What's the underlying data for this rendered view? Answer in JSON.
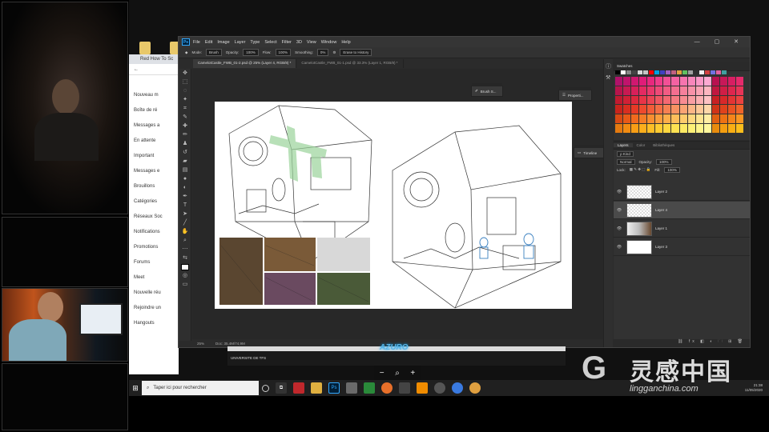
{
  "browser": {
    "tab_title": "Red How To Sc",
    "rows": [
      "Nouveau m",
      "Boîte de ré",
      "Messages a",
      "En attente",
      "Important",
      "Messages e",
      "Brouillons",
      "Catégories",
      "Réseaux Soc",
      "Notifications",
      "Promotions",
      "Forums",
      "Meet",
      "Nouvelle réu",
      "Rejoindre un",
      "Hangouts"
    ]
  },
  "photoshop": {
    "logo": "Ps",
    "menu": [
      "File",
      "Edit",
      "Image",
      "Layer",
      "Type",
      "Select",
      "Filter",
      "3D",
      "View",
      "Window",
      "Help"
    ],
    "window_controls": "— ▢ ✕",
    "options": {
      "mode_label": "Mode:",
      "mode_value": "Brush",
      "opacity_label": "Opacity:",
      "opacity_value": "100%",
      "flow_label": "Flow:",
      "flow_value": "100%",
      "smoothing_label": "Smoothing:",
      "smoothing_value": "0%",
      "erase_history": "Erase to History"
    },
    "tabs": [
      "CamelotCastle_FWB_01-2.psd @ 25% (Layer 4, RGB/8) *",
      "CamelotCastle_FWB_01-1.psd @ 33.3% (Layer 1, RGB/8) *"
    ],
    "status": {
      "zoom": "25%",
      "doc": "Doc: 35,4M/74,9M"
    },
    "float_panels": {
      "brush": "Brush S...",
      "properties": "Properti...",
      "timeline": "Timeline"
    },
    "swatches": {
      "title": "Swatches",
      "recent_colors": [
        "#000000",
        "#ffffff",
        "#888888",
        "#444444",
        "#d8d8d8",
        "#c4c4c4",
        "#ff0000",
        "#00a0e0",
        "#4040c0",
        "#a060c0",
        "#c06080",
        "#e0a040",
        "#60c060",
        "#a0a0a0",
        "#303030",
        "#f0f0f0",
        "#d04040",
        "#7070e0",
        "#e060a0",
        "#40a0a0"
      ],
      "palette": [
        "#b0126a",
        "#c0146c",
        "#d01870",
        "#e01c78",
        "#e8287e",
        "#ee3c8a",
        "#f25096",
        "#f462a2",
        "#f674ae",
        "#f886ba",
        "#fa98c6",
        "#fcaad2",
        "#b81250",
        "#c81858",
        "#d81e62",
        "#e62a6c",
        "#b8144c",
        "#c81a52",
        "#d8205a",
        "#e42a62",
        "#ea386c",
        "#ee4a78",
        "#f25c84",
        "#f46e90",
        "#f6809c",
        "#f892a8",
        "#faa4b4",
        "#fcb6c0",
        "#c01840",
        "#d01e46",
        "#de264e",
        "#e83458",
        "#c01a30",
        "#d02036",
        "#de283e",
        "#e83448",
        "#ec4454",
        "#f05662",
        "#f46872",
        "#f67a82",
        "#f88c92",
        "#fa9ea2",
        "#fcb0b2",
        "#fec2c4",
        "#c82024",
        "#d8282a",
        "#e43434",
        "#ec4240",
        "#c8241c",
        "#d82e20",
        "#e63a26",
        "#ee4a2e",
        "#f25c38",
        "#f46e44",
        "#f68052",
        "#f89262",
        "#faa474",
        "#fcb686",
        "#fdc898",
        "#fed8aa",
        "#d03418",
        "#e0421c",
        "#ea5222",
        "#f0642a",
        "#d84a14",
        "#e85a18",
        "#f06a1e",
        "#f47c26",
        "#f88e30",
        "#fa9e3c",
        "#fcae4a",
        "#fdbe5a",
        "#fecc6c",
        "#fed87e",
        "#fee490",
        "#ffeea4",
        "#e06012",
        "#ee7214",
        "#f6841a",
        "#fa9622",
        "#e47a10",
        "#f28c12",
        "#f89e16",
        "#fcae1c",
        "#fdbe26",
        "#fecc32",
        "#fed840",
        "#fee252",
        "#feea64",
        "#fef076",
        "#fef48a",
        "#fef89e",
        "#e88c0e",
        "#f49e10",
        "#faae14",
        "#fcbe1c"
      ]
    },
    "layers_panel": {
      "tabs": [
        "Layers",
        "Color",
        "Bibliothèques"
      ],
      "kind_label": "ρ Kind",
      "blend_mode": "Normal",
      "opacity_label": "Opacity:",
      "opacity_value": "100%",
      "lock_label": "Lock:",
      "fill_label": "Fill:",
      "fill_value": "100%",
      "layers": [
        {
          "name": "Layer 2",
          "thumb": "checker",
          "selected": false
        },
        {
          "name": "Layer 4",
          "thumb": "checker",
          "selected": true
        },
        {
          "name": "Layer 1",
          "thumb": "image",
          "selected": false
        },
        {
          "name": "Layer 3",
          "thumb": "white",
          "selected": false
        }
      ],
      "footer_icons": "⛓ fx ◧ ◐ 🗀 ⊞ 🗑"
    }
  },
  "overlay": {
    "logo": "AZURO",
    "text": "UNIVERSITE DE  TFS"
  },
  "zoom_control": {
    "minus": "−",
    "zoom": "⌕",
    "plus": "+"
  },
  "taskbar": {
    "start": "⊞",
    "search_placeholder": "Taper ici pour rechercher",
    "search_icon": "⌕",
    "tray_time": "21:38",
    "tray_date": "11/05/2020"
  },
  "watermark": {
    "logo_glyph": "G",
    "chinese": "灵感中国",
    "url": "lingganchina.com"
  }
}
